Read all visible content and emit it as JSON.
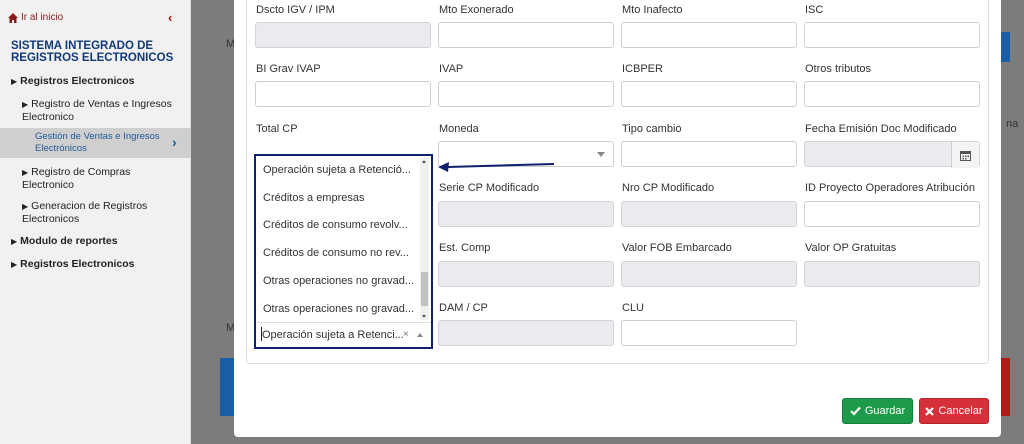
{
  "sidebar": {
    "back_label": "Ir al inicio",
    "system_title": "SISTEMA INTEGRADO DE REGISTROS ELECTRONICOS",
    "items": [
      {
        "label": "Registros Electronicos"
      },
      {
        "label": "Registro de Ventas e Ingresos Electronico"
      },
      {
        "label": "Gestión de Ventas e Ingresos Electrónicos"
      },
      {
        "label": "Registro de Compras Electronico"
      },
      {
        "label": "Generacion de Registros Electronicos"
      },
      {
        "label": "Modulo de reportes"
      },
      {
        "label": "Registros Electronicos"
      }
    ]
  },
  "background": {
    "m1": "M",
    "m2": "M",
    "na": "na"
  },
  "form": {
    "labels": {
      "dscto_igv": "Dscto IGV / IPM",
      "mto_exonerado": "Mto Exonerado",
      "mto_inafecto": "Mto Inafecto",
      "isc": "ISC",
      "bi_grav_ivap": "BI Grav IVAP",
      "ivap": "IVAP",
      "icbper": "ICBPER",
      "otros_tributos": "Otros tributos",
      "total_cp": "Total CP",
      "moneda": "Moneda",
      "tipo_cambio": "Tipo cambio",
      "fecha_emision_mod": "Fecha Emisión Doc Modificado",
      "serie_cp_mod": "Serie CP Modificado",
      "nro_cp_mod": "Nro CP Modificado",
      "id_proyecto": "ID Proyecto Operadores Atribución",
      "est_comp": "Est. Comp",
      "valor_fob": "Valor FOB Embarcado",
      "valor_op_gratuitas": "Valor OP Gratuitas",
      "dam_cp": "DAM / CP",
      "clu": "CLU"
    }
  },
  "dropdown": {
    "options": [
      "Operación sujeta a Retenció...",
      "Créditos a empresas",
      "Créditos de consumo revolv...",
      "Créditos de consumo no rev...",
      "Otras operaciones no gravad...",
      "Otras operaciones no gravad..."
    ],
    "selected": "Operación sujeta a Retenci...",
    "clear_glyph": "×"
  },
  "buttons": {
    "save": "Guardar",
    "cancel": "Cancelar"
  },
  "colors": {
    "save": "#1e9a4b",
    "cancel": "#d6303a",
    "annotation_arrow": "#121f6e"
  }
}
